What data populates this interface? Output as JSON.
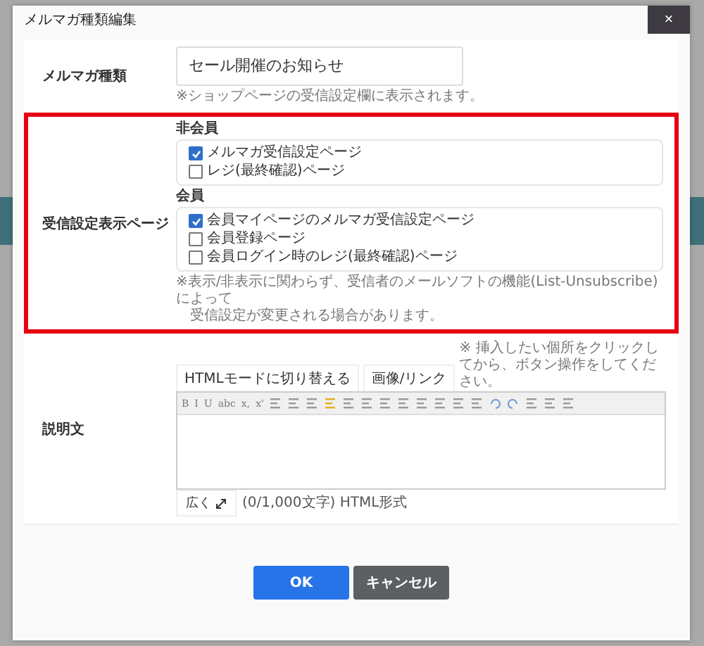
{
  "dialog": {
    "title": "メルマガ種類編集",
    "close": "×"
  },
  "name_row": {
    "label": "メルマガ種類",
    "value": "セール開催のお知らせ",
    "note": "※ショップページの受信設定欄に表示されます。"
  },
  "pages_row": {
    "label": "受信設定表示ページ",
    "highlighted": true,
    "groups": [
      {
        "title": "非会員",
        "options": [
          {
            "label": "メルマガ受信設定ページ",
            "checked": true
          },
          {
            "label": "レジ(最終確認)ページ",
            "checked": false
          }
        ]
      },
      {
        "title": "会員",
        "options": [
          {
            "label": "会員マイページのメルマガ受信設定ページ",
            "checked": true
          },
          {
            "label": "会員登録ページ",
            "checked": false
          },
          {
            "label": "会員ログイン時のレジ(最終確認)ページ",
            "checked": false
          }
        ]
      }
    ],
    "note_lines": [
      "※表示/非表示に関わらず、受信者のメールソフトの機能(List-Unsubscribe)によって",
      "受信設定が変更される場合があります。"
    ]
  },
  "description_row": {
    "label": "説明文",
    "tabs": [
      "HTMLモードに切り替える",
      "画像/リンク"
    ],
    "hint": "※ 挿入したい個所をクリックしてから、ボタン操作をしてください。",
    "toolbar_text": [
      "B",
      "I",
      "U",
      "abc",
      "x,",
      "x'"
    ],
    "expand": "広く",
    "counter": "(0/1,000文字) HTML形式"
  },
  "buttons": [
    {
      "label": "OK",
      "kind": "primary"
    },
    {
      "label": "キャンセル",
      "kind": "secondary"
    }
  ]
}
